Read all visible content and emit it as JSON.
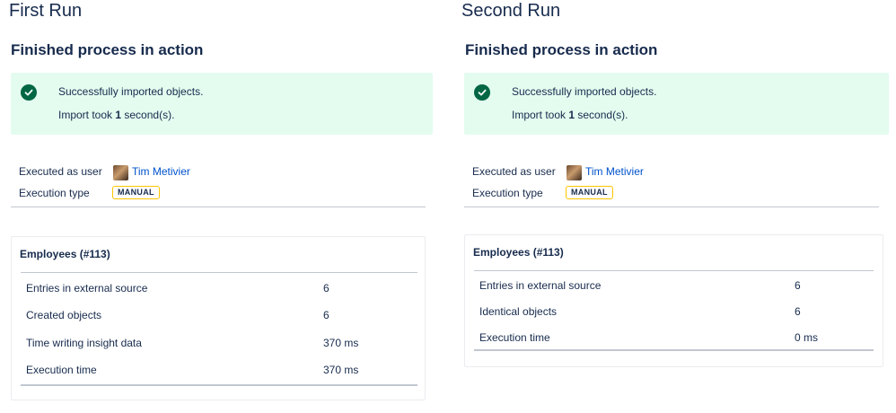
{
  "runs": [
    {
      "title": "First Run",
      "section_title": "Finished process in action",
      "success_message": "Successfully imported objects.",
      "import_prefix": "Import took ",
      "import_seconds": "1",
      "import_suffix": " second(s).",
      "executed_as_label": "Executed as user",
      "user_name": "Tim Metivier",
      "execution_type_label": "Execution type",
      "execution_type": "MANUAL",
      "card_title": "Employees (#113)",
      "stats": [
        {
          "label": "Entries in external source",
          "value": "6"
        },
        {
          "label": "Created objects",
          "value": "6"
        },
        {
          "label": "Time writing insight data",
          "value": "370 ms"
        },
        {
          "label": "Execution time",
          "value": "370 ms"
        }
      ]
    },
    {
      "title": "Second Run",
      "section_title": "Finished process in action",
      "success_message": "Successfully imported objects.",
      "import_prefix": "Import took ",
      "import_seconds": "1",
      "import_suffix": " second(s).",
      "executed_as_label": "Executed as user",
      "user_name": "Tim Metivier",
      "execution_type_label": "Execution type",
      "execution_type": "MANUAL",
      "card_title": "Employees (#113)",
      "stats": [
        {
          "label": "Entries in external source",
          "value": "6"
        },
        {
          "label": "Identical objects",
          "value": "6"
        },
        {
          "label": "Execution time",
          "value": "0 ms"
        }
      ]
    }
  ],
  "colors": {
    "success_bg": "#e3fcef",
    "success_icon": "#006644",
    "link": "#0052cc",
    "badge_border": "#ffc400",
    "text": "#172b4d"
  },
  "icons": {
    "success": "check-circle-icon",
    "avatar": "user-avatar"
  }
}
